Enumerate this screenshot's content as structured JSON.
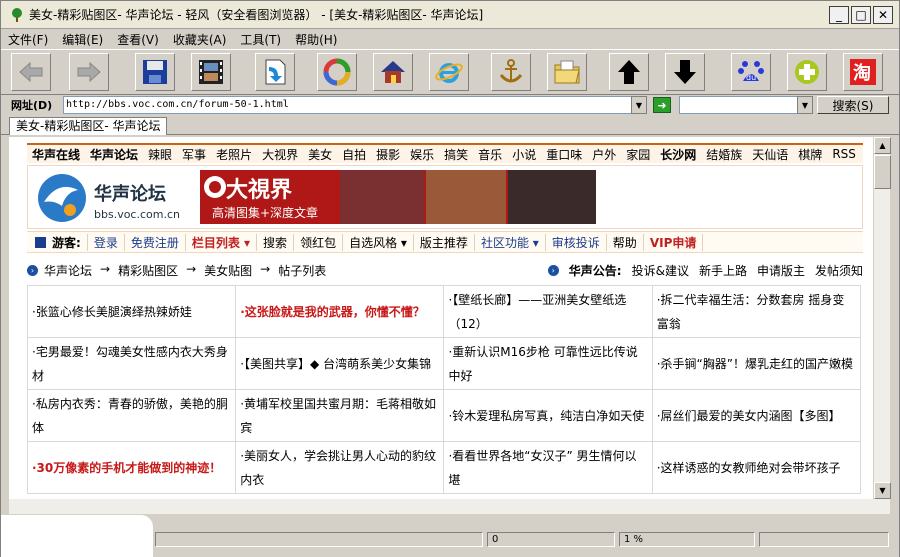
{
  "window": {
    "title": "美女-精彩贴图区- 华声论坛 - 轻风（安全看图浏览器） - [美女-精彩贴图区- 华声论坛]",
    "minimize": "_",
    "maximize": "□",
    "close": "✕"
  },
  "menu": [
    "文件(F)",
    "编辑(E)",
    "查看(V)",
    "收藏夹(A)",
    "工具(T)",
    "帮助(H)"
  ],
  "toolbar": {
    "buttons": [
      "back-icon",
      "forward-icon",
      "save-icon",
      "film-icon",
      "page-arrow-icon",
      "refresh-icon",
      "home-icon",
      "ie-icon",
      "anchor-icon",
      "folder-icon",
      "up-arrow-icon",
      "down-arrow-icon",
      "baidu-icon",
      "plus-icon",
      "taobao-icon"
    ],
    "baidu_text": "du",
    "taobao_text": "淘"
  },
  "address": {
    "label": "网址(D)",
    "url": "http://bbs.voc.com.cn/forum-50-1.html",
    "search_button": "搜索(S)"
  },
  "tab": {
    "label": "美女-精彩贴图区- 华声论坛"
  },
  "site": {
    "nav": [
      {
        "label": "华声在线",
        "bold": true
      },
      {
        "label": "华声论坛",
        "bold": true
      },
      {
        "label": "辣眼"
      },
      {
        "label": "军事"
      },
      {
        "label": "老照片"
      },
      {
        "label": "大视界"
      },
      {
        "label": "美女"
      },
      {
        "label": "自拍"
      },
      {
        "label": "摄影"
      },
      {
        "label": "娱乐"
      },
      {
        "label": "搞笑"
      },
      {
        "label": "音乐"
      },
      {
        "label": "小说"
      },
      {
        "label": "重口味"
      },
      {
        "label": "户外"
      },
      {
        "label": "家园"
      },
      {
        "label": "长沙网",
        "bold": true
      },
      {
        "label": "结婚族"
      },
      {
        "label": "天仙语"
      },
      {
        "label": "棋牌"
      },
      {
        "label": "RSS"
      }
    ],
    "logo_text": "华声论坛",
    "logo_url": "bbs.voc.com.cn",
    "banner_title": "大視界",
    "banner_sub": "高清图集+深度文章",
    "user_nav": {
      "guest_label": "游客:",
      "items": [
        {
          "label": "登录",
          "style": "blue"
        },
        {
          "label": "免费注册",
          "style": "blue"
        },
        {
          "label": "栏目列表 ▾",
          "style": "red"
        },
        {
          "label": "搜索",
          "style": ""
        },
        {
          "label": "领红包",
          "style": ""
        },
        {
          "label": "自选风格 ▾",
          "style": ""
        },
        {
          "label": "版主推荐",
          "style": ""
        },
        {
          "label": "社区功能 ▾",
          "style": "blue"
        },
        {
          "label": "审核投诉",
          "style": "blue"
        },
        {
          "label": "帮助",
          "style": ""
        },
        {
          "label": "VIP申请",
          "style": "red"
        }
      ]
    },
    "breadcrumb": [
      "华声论坛",
      "→",
      "精彩贴图区",
      "→",
      "美女贴图",
      "→",
      "帖子列表"
    ],
    "announcement": {
      "label": "华声公告:",
      "links": [
        "投诉&建议",
        "新手上路",
        "申请版主",
        "发帖须知"
      ]
    },
    "posts": [
      [
        {
          "text": "·张篮心修长美腿演绎热辣娇娃",
          "red": false
        },
        {
          "text": "·这张脸就是我的武器，你懂不懂？",
          "red": true
        },
        {
          "text": "·【壁纸长廊】——亚洲美女壁纸选（12）",
          "red": false
        },
        {
          "text": "·拆二代幸福生活：分数套房 摇身变富翁",
          "red": false
        }
      ],
      [
        {
          "text": "·宅男最爱！勾魂美女性感内衣大秀身材",
          "red": false
        },
        {
          "text": "·【美图共享】◆ 台湾萌系美少女集锦",
          "red": false
        },
        {
          "text": "·重新认识M16步枪 可靠性远比传说中好",
          "red": false
        },
        {
          "text": "·杀手锏“胸器”！爆乳走红的国产嫩模",
          "red": false
        }
      ],
      [
        {
          "text": "·私房内衣秀：青春的骄傲，美艳的胴体",
          "red": false
        },
        {
          "text": "·黄埔军校里国共蜜月期：毛蒋相敬如宾",
          "red": false
        },
        {
          "text": "·铃木爱理私房写真，纯洁白净如天使",
          "red": false
        },
        {
          "text": "·屌丝们最爱的美女内涵图【多图】",
          "red": false
        }
      ],
      [
        {
          "text": "·30万像素的手机才能做到的神迹！",
          "red": true
        },
        {
          "text": "·美丽女人，学会挑让男人心动的豹纹内衣",
          "red": false
        },
        {
          "text": "·看看世界各地“女汉子” 男生情何以堪",
          "red": false
        },
        {
          "text": "·这样诱惑的女教师绝对会带坏孩子",
          "red": false
        }
      ]
    ]
  },
  "status": {
    "cell1": "0",
    "cell2": "1 %"
  },
  "colors": {
    "accent": "#c86414",
    "link_blue": "#1b3d8f",
    "hot_red": "#c81818"
  }
}
